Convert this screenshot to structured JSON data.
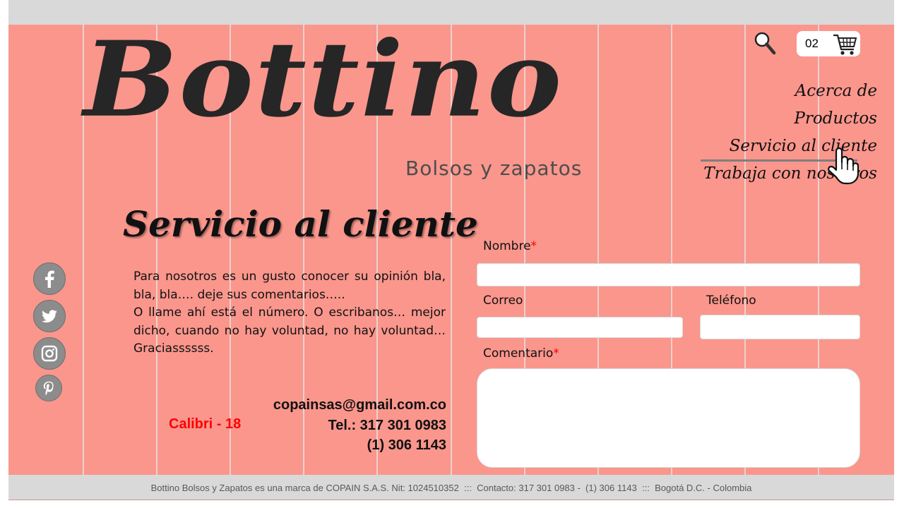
{
  "header": {
    "brand_name": "Bottino",
    "tagline": "Bolsos y zapatos",
    "search_icon": "magnifier-icon",
    "cart": {
      "count": "02",
      "icon": "shopping-cart-icon"
    }
  },
  "nav": {
    "items": [
      "Acerca de",
      "Productos",
      "Servicio al cliente",
      "Trabaja con nosotros"
    ],
    "active": "Servicio al cliente",
    "cursor_icon": "hand-pointer-icon"
  },
  "page": {
    "title": "Servicio al cliente",
    "intro_lines": [
      "Para nosotros es un gusto conocer su opinión bla, bla, bla…. deje sus comentarios…..",
      "O llame ahí está el número. O escribanos… mejor dicho, cuando no hay voluntad, no hay voluntad… Graciassssss."
    ],
    "contact": {
      "email": "copainsas@gmail.com.co",
      "phone1": "Tel.: 317 301 0983",
      "phone2": "(1) 306 1143"
    },
    "font_note": "Calibri - 18"
  },
  "social": [
    "facebook-icon",
    "twitter-icon",
    "instagram-icon",
    "pinterest-icon"
  ],
  "form": {
    "name_label": "Nombre",
    "email_label": "Correo",
    "phone_label": "Teléfono",
    "comment_label": "Comentario",
    "required_mark": "*"
  },
  "footer": {
    "text": "Bottino Bolsos y Zapatos es una marca de COPAIN S.A.S. Nit: 1024510352  :::  Contacto: 317 301 0983 -  (1) 306 1143  :::  Bogotá D.C. - Colombia"
  },
  "colors": {
    "background": "#fa968c",
    "bars": "#d9d9d9",
    "required": "#ff0000",
    "font_note": "#ff0000"
  }
}
